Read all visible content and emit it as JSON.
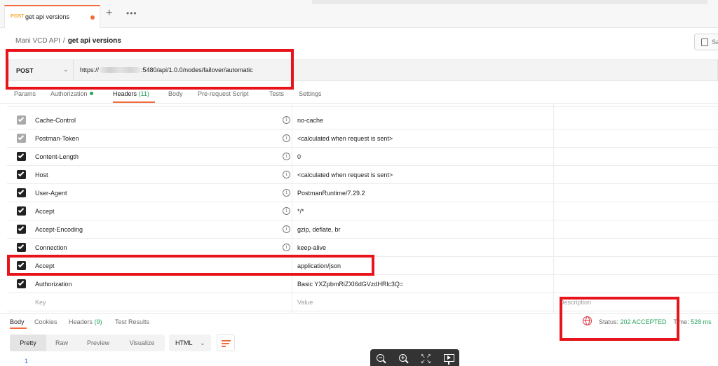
{
  "tab": {
    "method": "POST",
    "name": "get api versions"
  },
  "breadcrumb": {
    "collection": "Mani VCD API",
    "separator": "/",
    "request": "get api versions"
  },
  "save_label": "Sa",
  "request": {
    "method": "POST",
    "url_prefix": "https://",
    "url_suffix": ":5480/api/1.0.0/nodes/failover/automatic"
  },
  "request_tabs": [
    {
      "label": "Params"
    },
    {
      "label": "Authorization",
      "indicator": "green-dot"
    },
    {
      "label": "Headers",
      "count": "(11)"
    },
    {
      "label": "Body"
    },
    {
      "label": "Pre-request Script"
    },
    {
      "label": "Tests"
    },
    {
      "label": "Settings"
    }
  ],
  "headers": [
    {
      "key": "Cache-Control",
      "value": "no-cache",
      "checked": true,
      "auto": true,
      "info": true
    },
    {
      "key": "Postman-Token",
      "value": "<calculated when request is sent>",
      "checked": true,
      "auto": true,
      "info": true
    },
    {
      "key": "Content-Length",
      "value": "0",
      "checked": true,
      "auto": false,
      "info": true
    },
    {
      "key": "Host",
      "value": "<calculated when request is sent>",
      "checked": true,
      "auto": false,
      "info": true
    },
    {
      "key": "User-Agent",
      "value": "PostmanRuntime/7.29.2",
      "checked": true,
      "auto": false,
      "info": true
    },
    {
      "key": "Accept",
      "value": "*/*",
      "checked": true,
      "auto": false,
      "info": true
    },
    {
      "key": "Accept-Encoding",
      "value": "gzip, deflate, br",
      "checked": true,
      "auto": false,
      "info": true
    },
    {
      "key": "Connection",
      "value": "keep-alive",
      "checked": true,
      "auto": false,
      "info": true
    },
    {
      "key": "Accept",
      "value": "application/json",
      "checked": true,
      "auto": false,
      "info": false
    },
    {
      "key": "Authorization",
      "value": "Basic YXZpbmRiZXI6dGVzdHRlc3Q=",
      "checked": true,
      "auto": false,
      "info": false
    }
  ],
  "headers_placeholder": {
    "key": "Key",
    "value": "Value",
    "description": "Description"
  },
  "response_tabs": [
    {
      "label": "Body"
    },
    {
      "label": "Cookies"
    },
    {
      "label": "Headers",
      "count": "(9)"
    },
    {
      "label": "Test Results"
    }
  ],
  "response_status": {
    "status_label": "Status:",
    "status_value": "202 ACCEPTED",
    "time_label": "Time:",
    "time_value": "528 ms"
  },
  "view_modes": [
    "Pretty",
    "Raw",
    "Preview",
    "Visualize"
  ],
  "format": "HTML",
  "line_number": "1",
  "colors": {
    "accent": "#f26b3a",
    "success": "#26a35b",
    "annotation": "#e8141b",
    "post_method": "#f5a623"
  },
  "icons": [
    "plus-icon",
    "more-icon",
    "save-icon",
    "info-icon",
    "globe-icon",
    "wrap-icon",
    "zoom-out-icon",
    "zoom-in-icon",
    "fit-screen-icon",
    "present-icon"
  ]
}
